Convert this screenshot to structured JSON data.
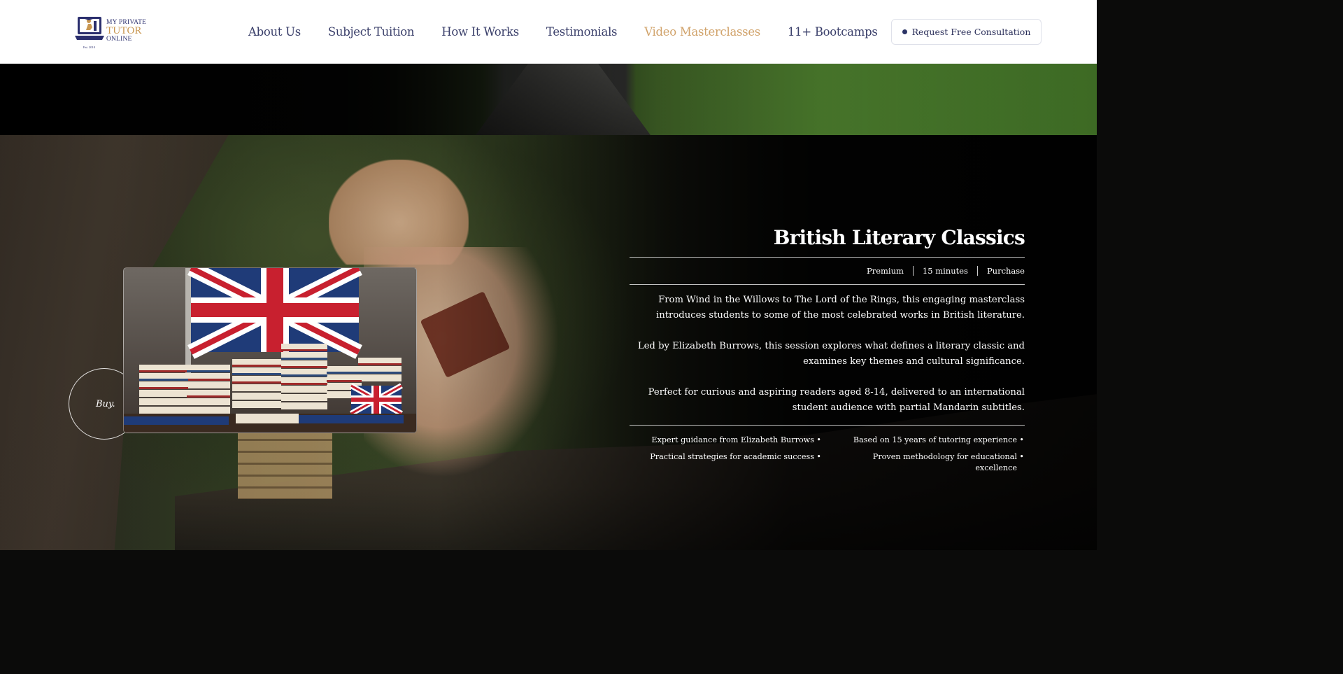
{
  "header": {
    "logo": {
      "line1": "MY PRIVATE",
      "line2": "TUTOR",
      "line3": "ONLINE",
      "est": "Est. 2010"
    },
    "nav": [
      {
        "label": "About Us"
      },
      {
        "label": "Subject Tuition"
      },
      {
        "label": "How It Works"
      },
      {
        "label": "Testimonials"
      },
      {
        "label": "Video Masterclasses",
        "active": true
      },
      {
        "label": "11+ Bootcamps"
      }
    ],
    "cta_label": "Request Free Consultation"
  },
  "hero": {
    "buy_label": "Buy.",
    "title": "British Literary Classics",
    "meta": [
      "Premium",
      "15 minutes",
      "Purchase"
    ],
    "description": [
      "From Wind in the Willows to The Lord of the Rings, this engaging masterclass introduces students to some of the most celebrated works in British literature.",
      "Led by Elizabeth Burrows, this session explores what defines a literary classic and examines key themes and cultural significance.",
      "Perfect for curious and aspiring readers aged 8-14, delivered to an international student audience with partial Mandarin subtitles."
    ],
    "features": [
      "Expert guidance from Elizabeth Burrows",
      "Based on 15 years of tutoring experience",
      "Practical strategies for academic success",
      "Proven methodology for educational excellence"
    ],
    "bullet": "•"
  },
  "colors": {
    "nav_text": "#3a3f6a",
    "nav_active": "#d1a36b",
    "brand_navy": "#2b2f6e",
    "brand_gold": "#c99751"
  }
}
